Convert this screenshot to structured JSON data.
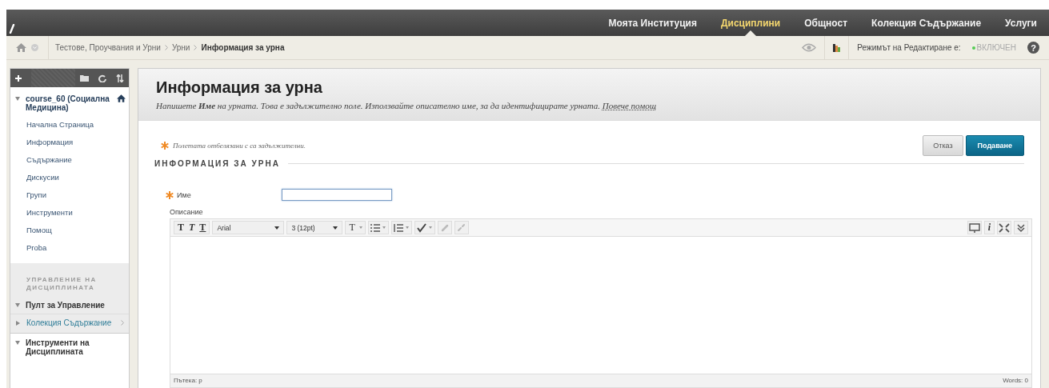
{
  "top_nav": {
    "items": [
      {
        "label": "Моята Институция",
        "selected": false
      },
      {
        "label": "Дисциплини",
        "selected": true
      },
      {
        "label": "Общност",
        "selected": false
      },
      {
        "label": "Колекция Съдържание",
        "selected": false
      },
      {
        "label": "Услуги",
        "selected": false
      }
    ]
  },
  "breadcrumb": {
    "items": [
      "Тестове, Проучвания и Урни",
      "Урни",
      "Информация за урна"
    ],
    "edit_mode_label": "Режимът на Редактиране е:",
    "edit_mode_value": "ВКЛЮЧЕН",
    "edit_mode_on": true,
    "help": "?"
  },
  "sidebar": {
    "course": {
      "title": "course_60 (Социална Медицина)",
      "expanded": true
    },
    "items": [
      "Начална Страница",
      "Информация",
      "Съдържание",
      "Дискусии",
      "Групи",
      "Инструменти",
      "Помощ",
      "Proba"
    ],
    "management": {
      "heading": "УПРАВЛЕНИЕ НА ДИСЦИПЛИНАТА",
      "items": [
        {
          "label": "Пулт за Управление",
          "expanded": true,
          "kind": "section"
        },
        {
          "label": "Колекция Съдържание",
          "expanded": false,
          "kind": "link"
        }
      ]
    },
    "tools": {
      "label": "Инструменти на Дисциплината",
      "expanded": true
    }
  },
  "page": {
    "title": "Информация за урна",
    "instructions": "Напишете **Име** на урната. Това е задължително поле. Използвайте описателно име, за да идентифицирате урната.",
    "help_link": "Повече помощ"
  },
  "form": {
    "required_note": "Полетата отбелязани с са задължителни.",
    "buttons": [
      {
        "label": "Отказ",
        "kind": "secondary"
      },
      {
        "label": "Подаване",
        "kind": "primary"
      }
    ],
    "section_title": "ИНФОРМАЦИЯ ЗА УРНА",
    "name_field": {
      "label": "Име",
      "required": true
    },
    "description": {
      "label": "Описание",
      "format_buttons": [
        "T",
        "T",
        "T"
      ],
      "font": "Arial",
      "size": "3 (12pt)",
      "text_color": "T",
      "info": "i",
      "path": "Пътека: p",
      "words": "Words: 0"
    }
  }
}
